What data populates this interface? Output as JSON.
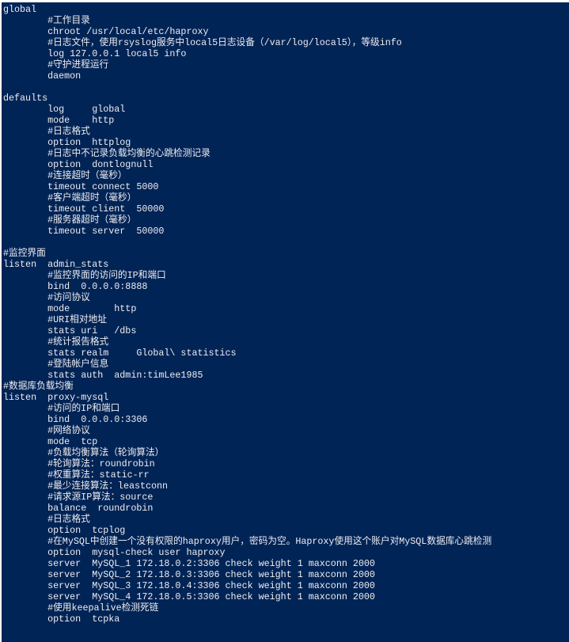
{
  "terminal": {
    "background": "#012456",
    "foreground": "#eeedf0",
    "lines": [
      "global",
      "        #工作目录",
      "        chroot /usr/local/etc/haproxy",
      "        #日志文件，使用rsyslog服务中local5日志设备（/var/log/local5），等级info",
      "        log 127.0.0.1 local5 info",
      "        #守护进程运行",
      "        daemon",
      "",
      "defaults",
      "        log     global",
      "        mode    http",
      "        #日志格式",
      "        option  httplog",
      "        #日志中不记录负载均衡的心跳检测记录",
      "        option  dontlognull",
      "        #连接超时（毫秒）",
      "        timeout connect 5000",
      "        #客户端超时（毫秒）",
      "        timeout client  50000",
      "        #服务器超时（毫秒）",
      "        timeout server  50000",
      "",
      "#监控界面",
      "listen  admin_stats",
      "        #监控界面的访问的IP和端口",
      "        bind  0.0.0.0:8888",
      "        #访问协议",
      "        mode        http",
      "        #URI相对地址",
      "        stats uri   /dbs",
      "        #统计报告格式",
      "        stats realm     Global\\ statistics",
      "        #登陆帐户信息",
      "        stats auth  admin:timLee1985",
      "#数据库负载均衡",
      "listen  proxy-mysql",
      "        #访问的IP和端口",
      "        bind  0.0.0.0:3306",
      "        #网络协议",
      "        mode  tcp",
      "        #负载均衡算法（轮询算法）",
      "        #轮询算法：roundrobin",
      "        #权重算法：static-rr",
      "        #最少连接算法：leastconn",
      "        #请求源IP算法：source",
      "        balance  roundrobin",
      "        #日志格式",
      "        option  tcplog",
      "        #在MySQL中创建一个没有权限的haproxy用户，密码为空。Haproxy使用这个账户对MySQL数据库心跳检测",
      "        option  mysql-check user haproxy",
      "        server  MySQL_1 172.18.0.2:3306 check weight 1 maxconn 2000",
      "        server  MySQL_2 172.18.0.3:3306 check weight 1 maxconn 2000",
      "        server  MySQL_3 172.18.0.4:3306 check weight 1 maxconn 2000",
      "        server  MySQL_4 172.18.0.5:3306 check weight 1 maxconn 2000",
      "        #使用keepalive检测死链",
      "        option  tcpka"
    ]
  }
}
